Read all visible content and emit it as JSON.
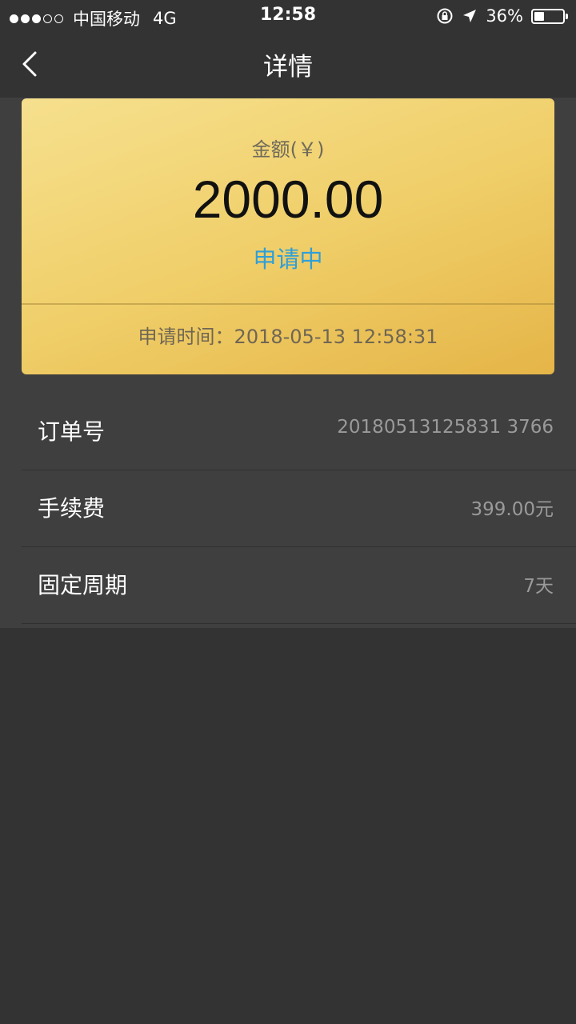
{
  "status_bar": {
    "carrier": "中国移动",
    "network": "4G",
    "time": "12:58",
    "battery_percent": "36%",
    "battery_level": 0.36
  },
  "nav": {
    "title": "详情",
    "back_icon": "chevron-left-icon"
  },
  "card": {
    "amount_label": "金额(￥)",
    "amount": "2000.00",
    "status": "申请中",
    "apply_time": "申请时间：2018-05-13 12:58:31",
    "status_color": "#2f9fd8"
  },
  "details": [
    {
      "label": "订单号",
      "value": "20180513125831 3766"
    },
    {
      "label": "手续费",
      "value": "399.00元"
    },
    {
      "label": "固定周期",
      "value": "7天"
    }
  ],
  "colors": {
    "background": "#333333",
    "panel": "#3f3f3f"
  }
}
